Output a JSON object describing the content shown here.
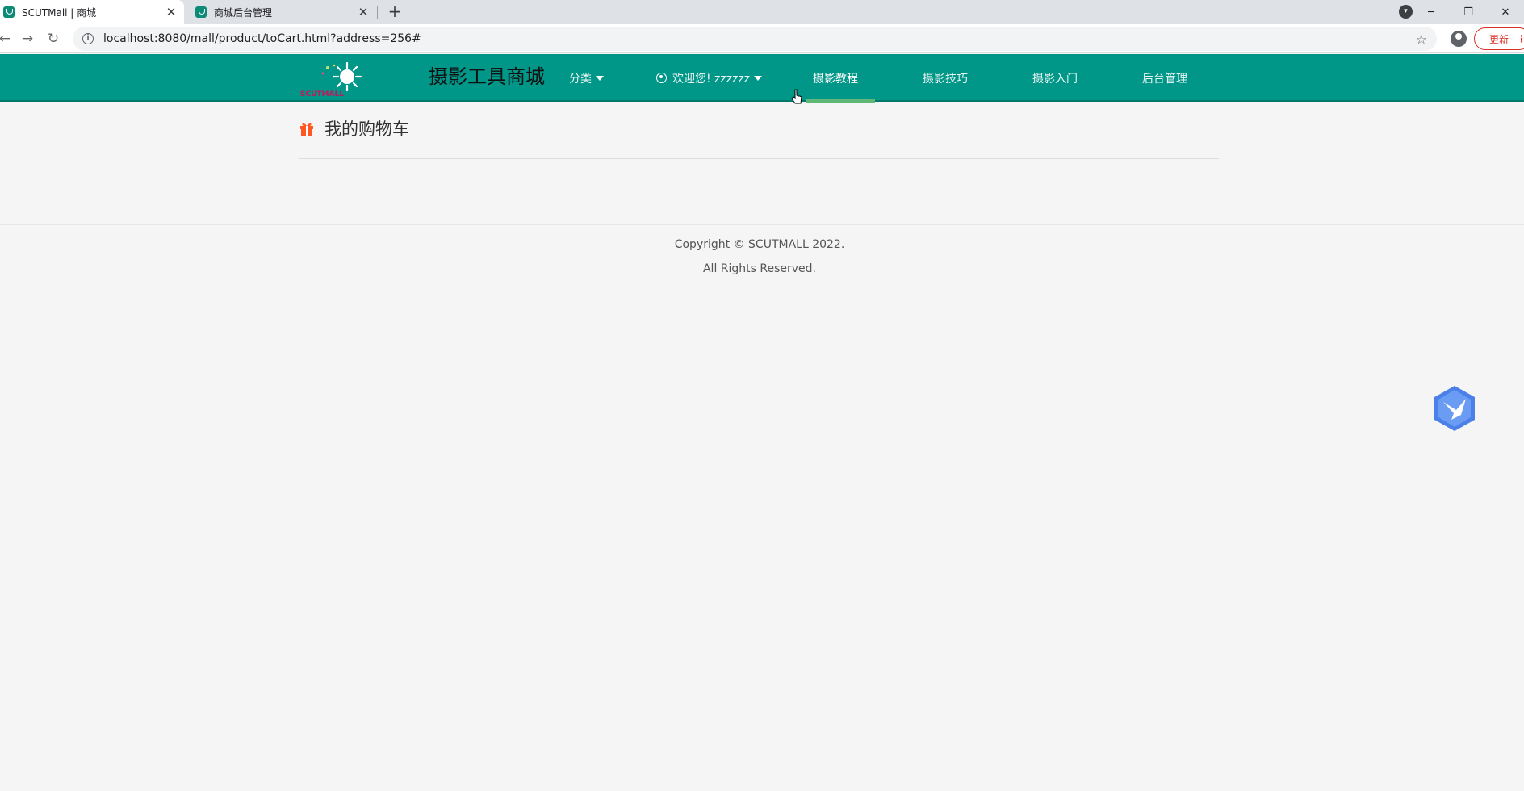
{
  "browser": {
    "tabs": [
      {
        "title": "SCUTMall | 商城",
        "active": true
      },
      {
        "title": "商城后台管理",
        "active": false
      }
    ],
    "url": "localhost:8080/mall/product/toCart.html?address=256#",
    "update_label": "更新"
  },
  "site": {
    "brand": "摄影工具商城",
    "logo_text": "SCUTMALL",
    "nav": {
      "category": "分类",
      "welcome": "欢迎您! zzzzzz",
      "tutorial": "摄影教程",
      "skills": "摄影技巧",
      "intro": "摄影入门",
      "admin": "后台管理"
    },
    "cart_title": "我的购物车",
    "footer": {
      "copyright": "Copyright © SCUTMALL 2022.",
      "rights": "All Rights Reserved."
    }
  },
  "colors": {
    "nav_bg": "#009688",
    "active_underline": "#5fb878",
    "gift_icon": "#ff5722",
    "update_red": "#d93025"
  }
}
